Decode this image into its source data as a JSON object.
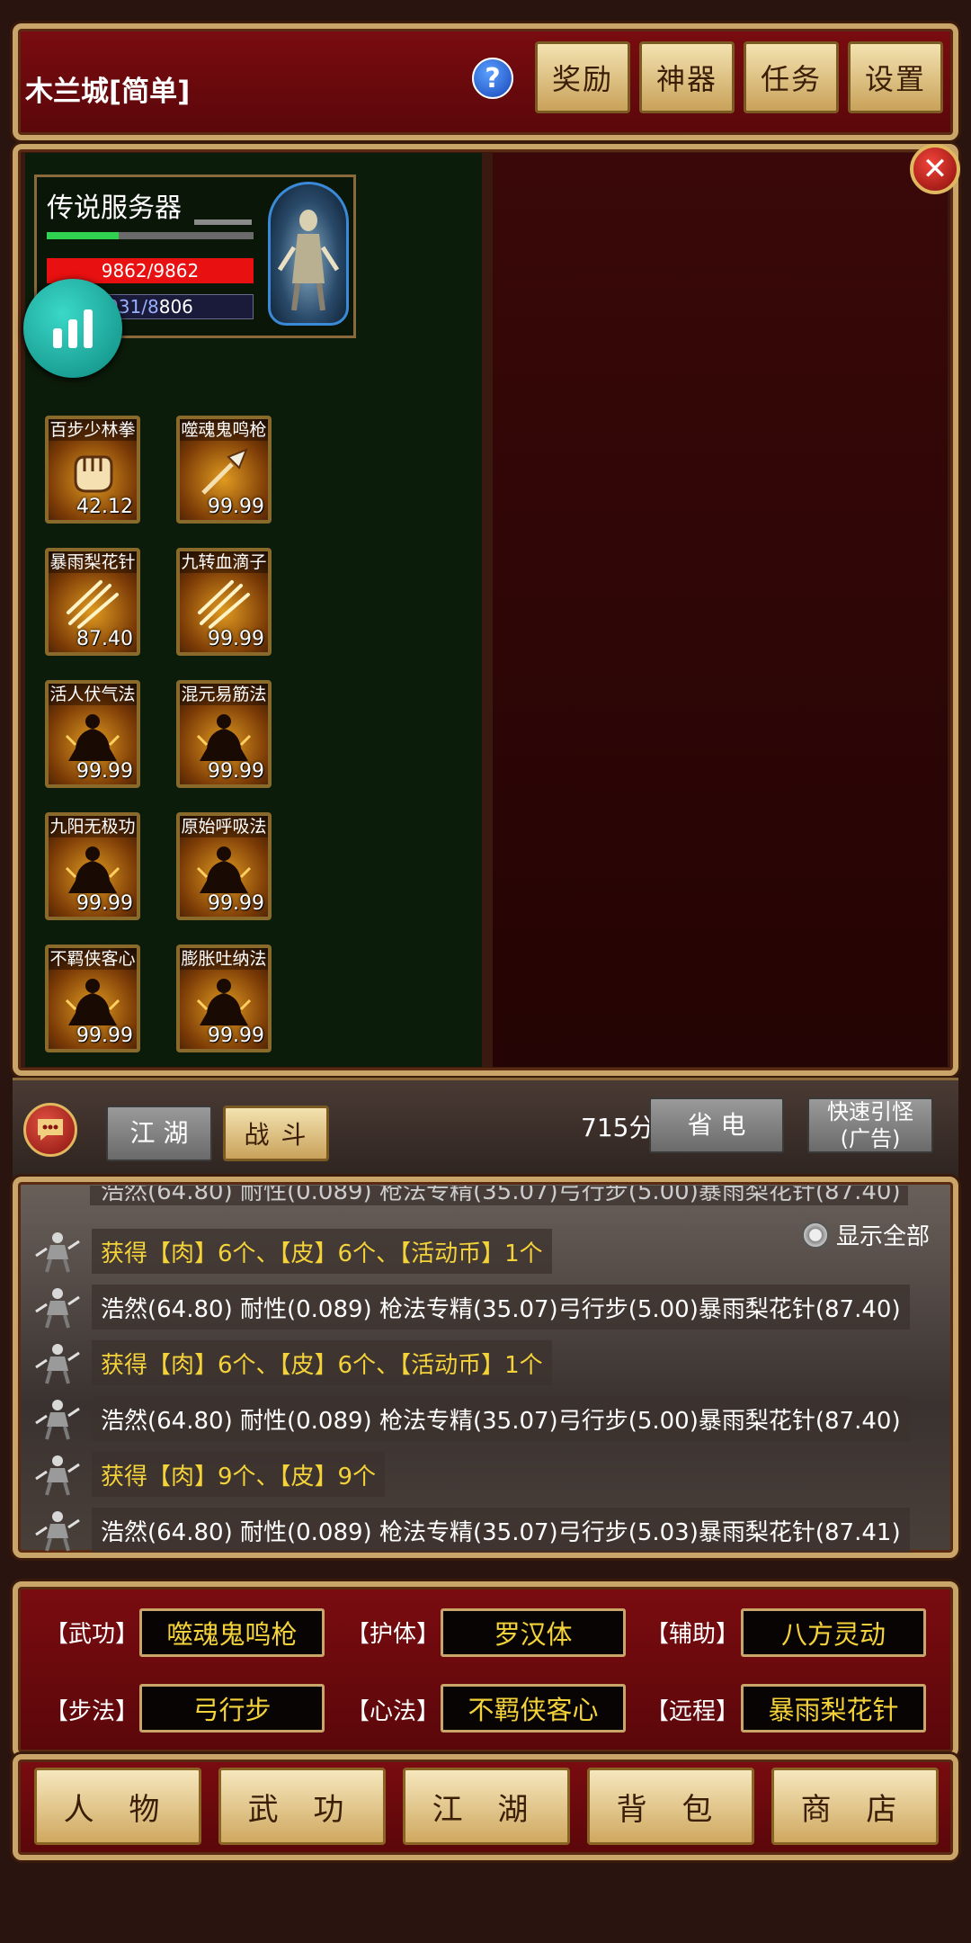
{
  "header": {
    "title": "木兰城[简单]",
    "buttons": [
      "奖励",
      "神器",
      "任务",
      "设置"
    ]
  },
  "player": {
    "server": "传说服务器",
    "hp": "9862/9862",
    "mp_partial": "931/8",
    "mp_rest": "806"
  },
  "skills": [
    {
      "name": "百步少林拳",
      "value": "42.12",
      "icon": "fist-icon"
    },
    {
      "name": "噬魂鬼鸣枪",
      "value": "99.99",
      "icon": "spear-icon"
    },
    {
      "name": "暴雨梨花针",
      "value": "87.40",
      "icon": "needle-icon"
    },
    {
      "name": "九转血滴子",
      "value": "99.99",
      "icon": "needle-icon"
    },
    {
      "name": "活人伏气法",
      "value": "99.99",
      "icon": "meditation-icon"
    },
    {
      "name": "混元易筋法",
      "value": "99.99",
      "icon": "meditation-icon"
    },
    {
      "name": "九阳无极功",
      "value": "99.99",
      "icon": "meditation-icon"
    },
    {
      "name": "原始呼吸法",
      "value": "99.99",
      "icon": "meditation-icon"
    },
    {
      "name": "不羁侠客心",
      "value": "99.99",
      "icon": "meditation-icon"
    },
    {
      "name": "膨胀吐纳法",
      "value": "99.99",
      "icon": "meditation-icon"
    }
  ],
  "tabs": {
    "jianghu": "江 湖",
    "battle": "战 斗",
    "score": "715分",
    "power_save": "省 电",
    "quick_lure": "快速引怪",
    "quick_lure_sub": "(广告)"
  },
  "log": {
    "show_all": "显示全部",
    "entries": [
      {
        "type": "loot",
        "text": "获得【肉】6个、【皮】6个、【活动币】1个"
      },
      {
        "type": "stat",
        "text": "浩然(64.80) 耐性(0.089) 枪法专精(35.07)弓行步(5.00)暴雨梨花针(87.40)"
      },
      {
        "type": "loot",
        "text": "获得【肉】6个、【皮】6个、【活动币】1个"
      },
      {
        "type": "stat",
        "text": "浩然(64.80) 耐性(0.089) 枪法专精(35.07)弓行步(5.00)暴雨梨花针(87.40)"
      },
      {
        "type": "loot",
        "text": "获得【肉】9个、【皮】9个"
      },
      {
        "type": "stat",
        "text": "浩然(64.80) 耐性(0.089) 枪法专精(35.07)弓行步(5.03)暴雨梨花针(87.41)"
      }
    ]
  },
  "equip": {
    "wugong_label": "【武功】",
    "wugong": "噬魂鬼鸣枪",
    "huti_label": "【护体】",
    "huti": "罗汉体",
    "fuzhu_label": "【辅助】",
    "fuzhu": "八方灵动",
    "bufa_label": "【步法】",
    "bufa": "弓行步",
    "xinfa_label": "【心法】",
    "xinfa": "不羁侠客心",
    "yuancheng_label": "【远程】",
    "yuancheng": "暴雨梨花针"
  },
  "nav": [
    "人 物",
    "武 功",
    "江 湖",
    "背 包",
    "商 店"
  ],
  "colors": {
    "gold": "#f4d23a",
    "frame": "#c9a56a",
    "red": "#7a0c10"
  }
}
